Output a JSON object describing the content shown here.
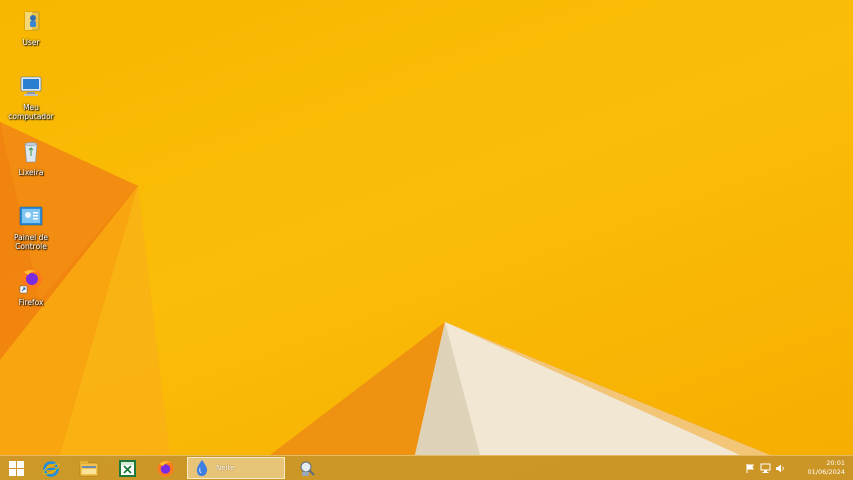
{
  "desktop": {
    "icons": [
      {
        "label": "User",
        "icon": "user-folder-icon"
      },
      {
        "label": "Meu computador",
        "icon": "computer-icon"
      },
      {
        "label": "Lixeira",
        "icon": "recycle-bin-icon"
      },
      {
        "label": "Painel de Controle",
        "icon": "control-panel-icon"
      },
      {
        "label": "Firefox",
        "icon": "firefox-icon"
      }
    ]
  },
  "taskbar": {
    "pinned": [
      {
        "name": "start",
        "icon": "windows-logo-icon"
      },
      {
        "name": "internet-explorer",
        "icon": "internet-explorer-icon"
      },
      {
        "name": "file-explorer",
        "icon": "file-explorer-icon"
      },
      {
        "name": "excel",
        "icon": "excel-icon"
      },
      {
        "name": "firefox",
        "icon": "firefox-icon"
      }
    ],
    "active_window": {
      "label": "Neite",
      "icon": "droplet-app-icon"
    },
    "extra": {
      "name": "utility",
      "icon": "magnifier-tool-icon"
    },
    "tray": {
      "icons": [
        "flag-icon",
        "network-icon",
        "volume-icon"
      ],
      "time": "20:01",
      "date": "01/06/2024"
    }
  },
  "colors": {
    "wallpaper": "#fbbd08",
    "facet_dark": "#ef7a0c",
    "facet_white": "#f1e7d3",
    "taskbar": "#c4922e"
  }
}
